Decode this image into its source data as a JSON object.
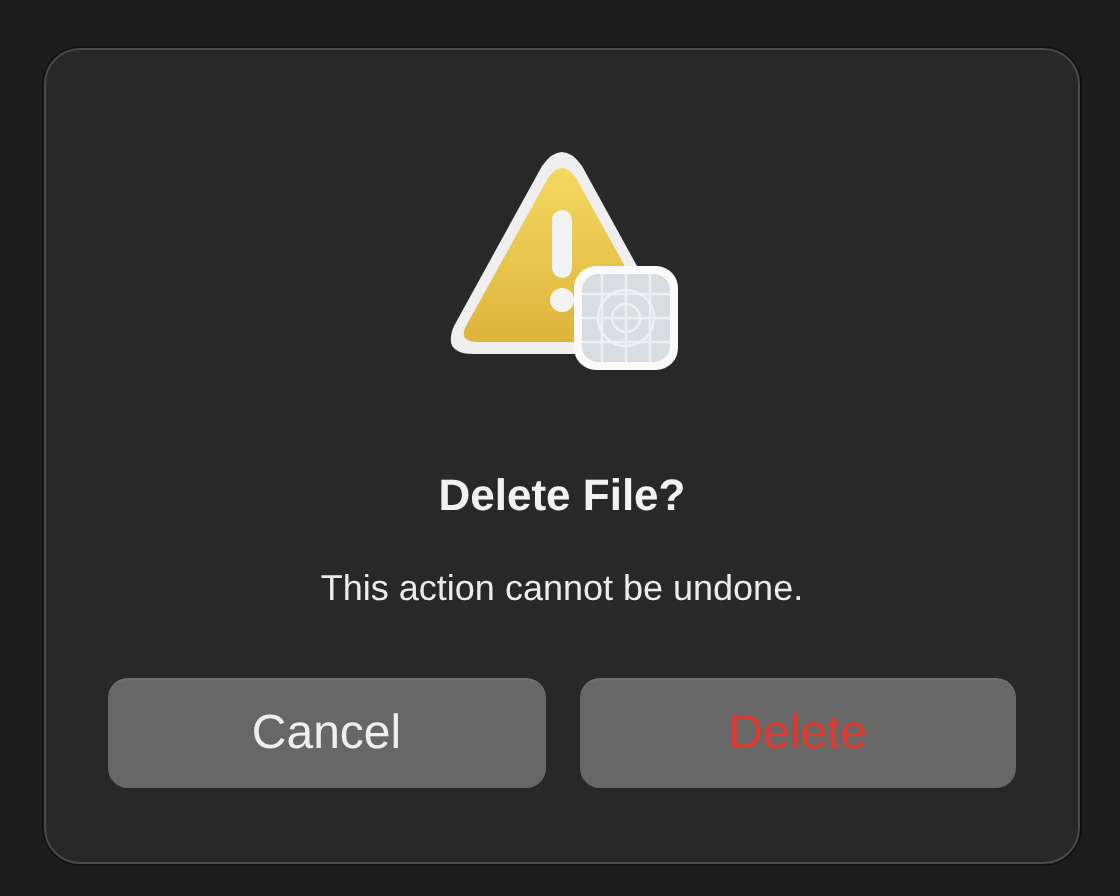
{
  "dialog": {
    "title": "Delete File?",
    "message": "This action cannot be undone.",
    "buttons": [
      {
        "label": "Cancel",
        "kind": "normal"
      },
      {
        "label": "Delete",
        "kind": "destructive"
      }
    ]
  }
}
